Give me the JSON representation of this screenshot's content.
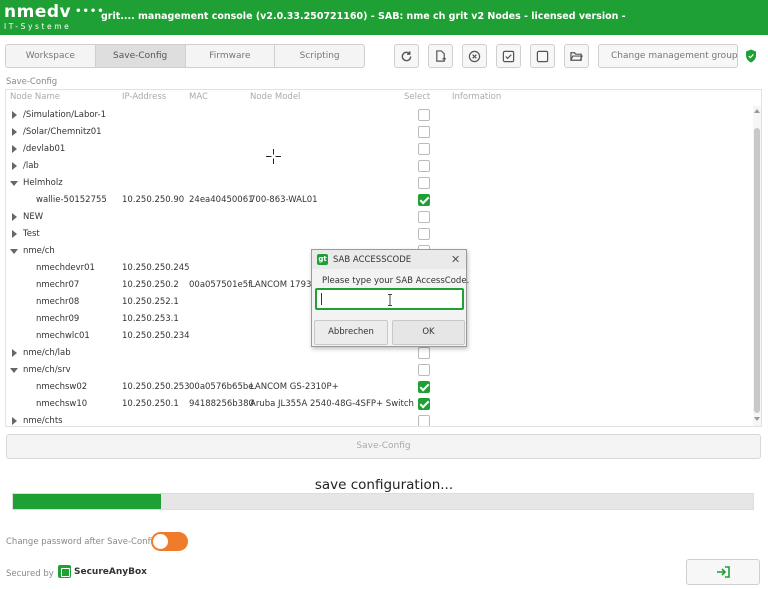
{
  "app": {
    "logo_main": "nmedv",
    "logo_dots": "••••",
    "logo_sub": "IT-Systeme",
    "title": "grit.... management console (v2.0.33.250721160) - SAB: nme ch grit v2 Nodes - licensed version -"
  },
  "tabs": [
    {
      "label": "Workspace",
      "active": false
    },
    {
      "label": "Save-Config",
      "active": true
    },
    {
      "label": "Firmware",
      "active": false
    },
    {
      "label": "Scripting",
      "active": false
    }
  ],
  "toolbar": {
    "icons": [
      "refresh-icon",
      "add-document-icon",
      "cancel-circle-icon",
      "check-box-icon",
      "empty-box-icon",
      "folder-open-icon"
    ],
    "change_group_label": "Change management group"
  },
  "section_label": "Save-Config",
  "table": {
    "columns": [
      "Node Name",
      "IP-Address",
      "MAC",
      "Node Model",
      "Select",
      "Information"
    ],
    "rows": [
      {
        "name": "/Simulation/Labor-1",
        "ip": "",
        "mac": "",
        "model": "",
        "indent": 0,
        "expander": "right",
        "checked": false
      },
      {
        "name": "/Solar/Chemnitz01",
        "ip": "",
        "mac": "",
        "model": "",
        "indent": 0,
        "expander": "right",
        "checked": false
      },
      {
        "name": "/devlab01",
        "ip": "",
        "mac": "",
        "model": "",
        "indent": 0,
        "expander": "right",
        "checked": false
      },
      {
        "name": "/lab",
        "ip": "",
        "mac": "",
        "model": "",
        "indent": 0,
        "expander": "right",
        "checked": false
      },
      {
        "name": "Helmholz",
        "ip": "",
        "mac": "",
        "model": "",
        "indent": 0,
        "expander": "down",
        "checked": false
      },
      {
        "name": "wallie-50152755",
        "ip": "10.250.250.90",
        "mac": "24ea40450061",
        "model": "700-863-WAL01",
        "indent": 1,
        "expander": "",
        "checked": true
      },
      {
        "name": "NEW",
        "ip": "",
        "mac": "",
        "model": "",
        "indent": 0,
        "expander": "right",
        "checked": false
      },
      {
        "name": "Test",
        "ip": "",
        "mac": "",
        "model": "",
        "indent": 0,
        "expander": "right",
        "checked": false
      },
      {
        "name": "nme/ch",
        "ip": "",
        "mac": "",
        "model": "",
        "indent": 0,
        "expander": "down",
        "checked": false
      },
      {
        "name": "nmechdevr01",
        "ip": "10.250.250.245",
        "mac": "",
        "model": "",
        "indent": 1,
        "expander": "",
        "checked": false
      },
      {
        "name": "nmechr07",
        "ip": "10.250.250.2",
        "mac": "00a057501e5f",
        "model": "LANCOM 1793V",
        "indent": 1,
        "expander": "",
        "checked": false
      },
      {
        "name": "nmechr08",
        "ip": "10.250.252.1",
        "mac": "",
        "model": "",
        "indent": 1,
        "expander": "",
        "checked": false
      },
      {
        "name": "nmechr09",
        "ip": "10.250.253.1",
        "mac": "",
        "model": "",
        "indent": 1,
        "expander": "",
        "checked": false
      },
      {
        "name": "nmechwlc01",
        "ip": "10.250.250.234",
        "mac": "",
        "model": "",
        "indent": 1,
        "expander": "",
        "checked": false
      },
      {
        "name": "nme/ch/lab",
        "ip": "",
        "mac": "",
        "model": "",
        "indent": 0,
        "expander": "right",
        "checked": false
      },
      {
        "name": "nme/ch/srv",
        "ip": "",
        "mac": "",
        "model": "",
        "indent": 0,
        "expander": "down",
        "checked": false
      },
      {
        "name": "nmechsw02",
        "ip": "10.250.250.253",
        "mac": "00a0576b65be",
        "model": "LANCOM GS-2310P+",
        "indent": 1,
        "expander": "",
        "checked": true
      },
      {
        "name": "nmechsw10",
        "ip": "10.250.250.1",
        "mac": "94188256b380",
        "model": "Aruba JL355A 2540-48G-4SFP+ Switch",
        "indent": 1,
        "expander": "",
        "checked": true
      },
      {
        "name": "nme/chts",
        "ip": "",
        "mac": "",
        "model": "",
        "indent": 0,
        "expander": "right",
        "checked": false
      }
    ]
  },
  "save_button_label": "Save-Config",
  "progress": {
    "label": "save configuration...",
    "value": 0.2
  },
  "password_toggle": {
    "label": "Change password after Save-Config",
    "on": true
  },
  "secured_by": {
    "label": "Secured by",
    "brand": "SecureAnyBox"
  },
  "dialog": {
    "title": "SAB ACCESSCODE",
    "icon_text": "gt",
    "prompt": "Please type your SAB AccessCode.",
    "input_value": "",
    "cancel_label": "Abbrechen",
    "ok_label": "OK"
  },
  "colors": {
    "accent": "#1fa035",
    "toggle": "#f07c2b"
  }
}
